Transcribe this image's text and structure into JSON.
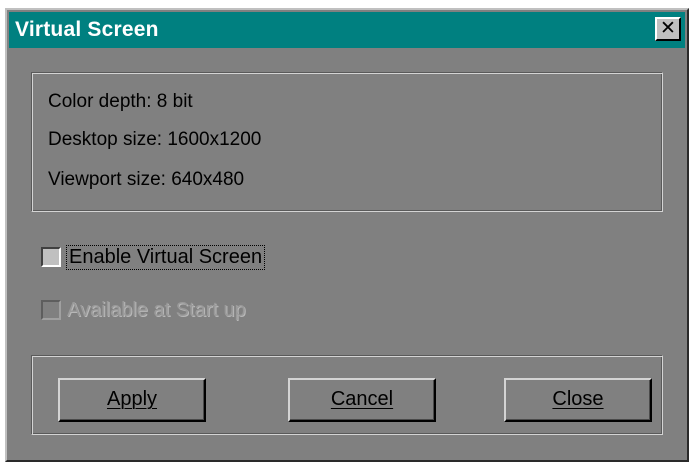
{
  "window": {
    "title": "Virtual Screen",
    "close_glyph": "✕",
    "close_icon": "close-icon"
  },
  "info": {
    "color_depth": "Color depth: 8 bit",
    "desktop_size": "Desktop size: 1600x1200",
    "viewport_size": "Viewport size: 640x480"
  },
  "options": {
    "enable_virtual_screen": {
      "label": "Enable Virtual Screen",
      "checked": false,
      "enabled": true
    },
    "available_at_startup": {
      "label": "Available at Start up",
      "checked": false,
      "enabled": false
    }
  },
  "buttons": {
    "apply": "Apply",
    "cancel": "Cancel",
    "close": "Close"
  },
  "colors": {
    "titlebar": "#008080",
    "dialog_face": "#808080"
  }
}
